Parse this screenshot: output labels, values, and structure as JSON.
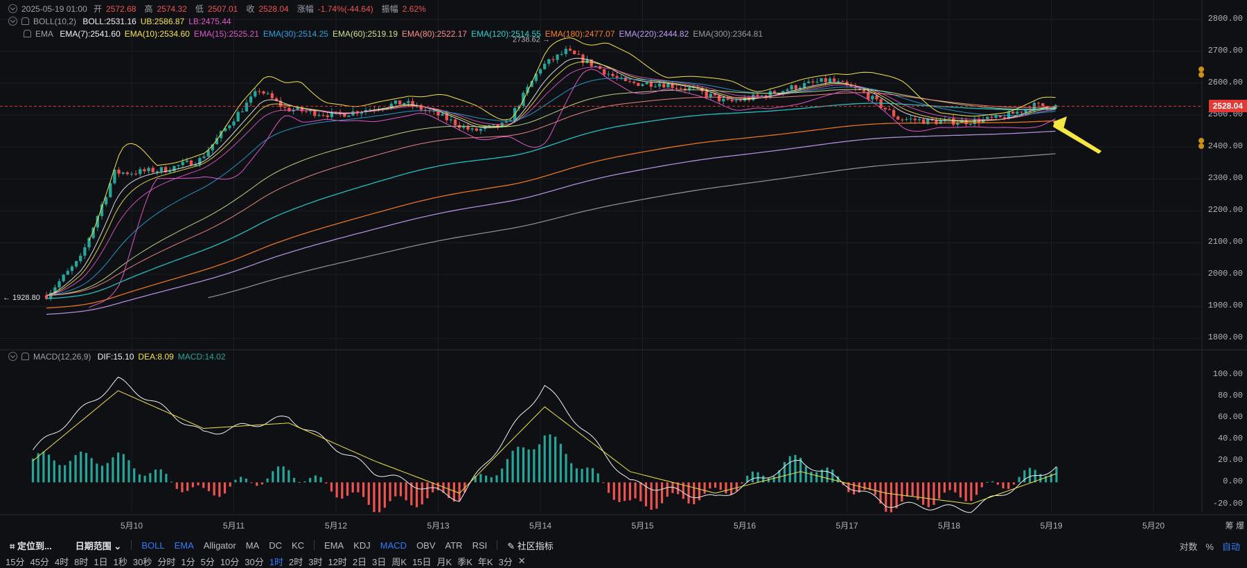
{
  "header": {
    "datetime": "2025-05-19 01:00",
    "ohlc": [
      {
        "label": "开",
        "value": "2572.68"
      },
      {
        "label": "高",
        "value": "2574.32"
      },
      {
        "label": "低",
        "value": "2507.01"
      },
      {
        "label": "收",
        "value": "2528.04"
      },
      {
        "label": "涨幅",
        "value": "-1.74%(-44.64)"
      },
      {
        "label": "振幅",
        "value": "2.62%"
      }
    ]
  },
  "boll_legend": {
    "name": "BOLL(10,2)",
    "items": [
      {
        "text": "BOLL:2531.16",
        "color": "#f2f2f2"
      },
      {
        "text": "UB:2586.87",
        "color": "#f5e642"
      },
      {
        "text": "LB:2475.44",
        "color": "#e056c8"
      }
    ]
  },
  "ema_legend": {
    "name": "EMA",
    "items": [
      {
        "text": "EMA(7):2541.60",
        "color": "#f2f2f2"
      },
      {
        "text": "EMA(10):2534.60",
        "color": "#f5e642"
      },
      {
        "text": "EMA(15):2525.21",
        "color": "#e056c8"
      },
      {
        "text": "EMA(30):2514.25",
        "color": "#29a3e0"
      },
      {
        "text": "EMA(60):2519.19",
        "color": "#cbe58a"
      },
      {
        "text": "EMA(80):2522.17",
        "color": "#ff8f8f"
      },
      {
        "text": "EMA(120):2514.55",
        "color": "#23d4d4"
      },
      {
        "text": "EMA(180):2477.07",
        "color": "#ff7f1f"
      },
      {
        "text": "EMA(220):2444.82",
        "color": "#c29cf5"
      },
      {
        "text": "EMA(300):2364.81",
        "color": "#9a9a9a"
      }
    ]
  },
  "macd_legend": {
    "name": "MACD(12,26,9)",
    "items": [
      {
        "text": "DIF:15.10",
        "color": "#f2f2f2"
      },
      {
        "text": "DEA:8.09",
        "color": "#f5e642"
      },
      {
        "text": "MACD:14.02",
        "color": "#26a69a"
      }
    ]
  },
  "price_yaxis": [
    "2800.00",
    "2700.00",
    "2600.00",
    "2500.00",
    "2400.00",
    "2300.00",
    "2200.00",
    "2100.00",
    "2000.00",
    "1900.00",
    "1800.00"
  ],
  "macd_yaxis": [
    "100.00",
    "80.00",
    "60.00",
    "40.00",
    "20.00",
    "0.00",
    "-20.00"
  ],
  "xaxis": [
    "5月10",
    "5月11",
    "5月12",
    "5月13",
    "5月14",
    "5月15",
    "5月16",
    "5月17",
    "5月18",
    "5月19",
    "5月20"
  ],
  "last_price": "2528.04",
  "high_annotation": "2738.62",
  "low_annotation": "1928.80",
  "corner_labels": [
    "筹",
    "爆"
  ],
  "toolbar": {
    "locate": "定位到...",
    "date_range": "日期范围",
    "main_indicators": [
      "BOLL",
      "EMA",
      "Alligator",
      "MA",
      "DC",
      "KC"
    ],
    "sub_indicators": [
      "EMA",
      "KDJ",
      "MACD",
      "OBV",
      "ATR",
      "RSI"
    ],
    "community": "社区指标",
    "right": [
      "对数",
      "%",
      "自动"
    ]
  },
  "timeframes": [
    "15分",
    "45分",
    "4时",
    "8时",
    "1日",
    "1秒",
    "30秒",
    "分时",
    "1分",
    "5分",
    "10分",
    "30分",
    "1时",
    "2时",
    "3时",
    "12时",
    "2日",
    "3日",
    "周K",
    "15日",
    "月K",
    "季K",
    "年K",
    "3分"
  ],
  "active_timeframe": "1时",
  "chart_data": {
    "type": "candlestick",
    "interval": "1h",
    "x_range": [
      "2025-05-09",
      "2025-05-20"
    ],
    "price_ylim": [
      1780,
      2830
    ],
    "macd_ylim": [
      -28,
      110
    ],
    "closes_sampled": [
      [
        "2025-05-09 04:00",
        1935
      ],
      [
        "2025-05-09 12:00",
        2050
      ],
      [
        "2025-05-09 20:00",
        2320
      ],
      [
        "2025-05-10 00:00",
        2320
      ],
      [
        "2025-05-10 08:00",
        2330
      ],
      [
        "2025-05-10 16:00",
        2360
      ],
      [
        "2025-05-11 00:00",
        2490
      ],
      [
        "2025-05-11 06:00",
        2580
      ],
      [
        "2025-05-11 12:00",
        2520
      ],
      [
        "2025-05-11 18:00",
        2510
      ],
      [
        "2025-05-12 00:00",
        2500
      ],
      [
        "2025-05-12 08:00",
        2520
      ],
      [
        "2025-05-12 16:00",
        2540
      ],
      [
        "2025-05-13 00:00",
        2500
      ],
      [
        "2025-05-13 08:00",
        2450
      ],
      [
        "2025-05-13 16:00",
        2470
      ],
      [
        "2025-05-14 00:00",
        2650
      ],
      [
        "2025-05-14 06:00",
        2700
      ],
      [
        "2025-05-14 12:00",
        2660
      ],
      [
        "2025-05-14 20:00",
        2600
      ],
      [
        "2025-05-15 04:00",
        2600
      ],
      [
        "2025-05-15 12:00",
        2580
      ],
      [
        "2025-05-15 20:00",
        2540
      ],
      [
        "2025-05-16 04:00",
        2560
      ],
      [
        "2025-05-16 12:00",
        2590
      ],
      [
        "2025-05-16 20:00",
        2610
      ],
      [
        "2025-05-17 04:00",
        2570
      ],
      [
        "2025-05-17 12:00",
        2490
      ],
      [
        "2025-05-17 20:00",
        2480
      ],
      [
        "2025-05-18 04:00",
        2480
      ],
      [
        "2025-05-18 12:00",
        2490
      ],
      [
        "2025-05-18 20:00",
        2530
      ],
      [
        "2025-05-19 01:00",
        2528.04
      ]
    ],
    "ema_endpoints": {
      "EMA(7)": 2541.6,
      "EMA(10)": 2534.6,
      "EMA(15)": 2525.21,
      "EMA(30)": 2514.25,
      "EMA(60)": 2519.19,
      "EMA(80)": 2522.17,
      "EMA(120)": 2514.55,
      "EMA(180)": 2477.07,
      "EMA(220)": 2444.82,
      "EMA(300)": 2364.81
    },
    "macd_sampled": {
      "dif": [
        [
          0,
          30
        ],
        [
          8,
          95
        ],
        [
          16,
          45
        ],
        [
          24,
          60
        ],
        [
          32,
          10
        ],
        [
          40,
          -15
        ],
        [
          48,
          90
        ],
        [
          56,
          0
        ],
        [
          64,
          -15
        ],
        [
          72,
          20
        ],
        [
          80,
          -20
        ],
        [
          88,
          -25
        ],
        [
          96,
          15.1
        ]
      ],
      "dea": [
        [
          0,
          20
        ],
        [
          8,
          85
        ],
        [
          16,
          50
        ],
        [
          24,
          55
        ],
        [
          32,
          20
        ],
        [
          40,
          -10
        ],
        [
          48,
          70
        ],
        [
          56,
          10
        ],
        [
          64,
          -10
        ],
        [
          72,
          10
        ],
        [
          80,
          -10
        ],
        [
          88,
          -20
        ],
        [
          96,
          8.09
        ]
      ]
    }
  }
}
